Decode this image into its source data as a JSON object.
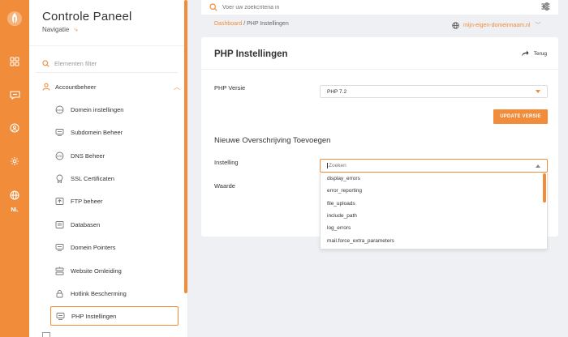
{
  "rail": {
    "icons": [
      "logo-icon",
      "apps-grid-icon",
      "chat-icon",
      "user-circle-icon",
      "gear-icon",
      "globe-icon"
    ],
    "language": "NL"
  },
  "sidebar": {
    "title": "Controle Paneel",
    "subtitle": "Navigatie",
    "filter_placeholder": "Elementen filter",
    "group": {
      "label": "Accountbeheer",
      "icon": "user-icon"
    },
    "items": [
      {
        "label": "Domein instellingen",
        "icon": "domain-settings-icon"
      },
      {
        "label": "Subdomein Beheer",
        "icon": "subdomain-icon"
      },
      {
        "label": "DNS Beheer",
        "icon": "dns-icon"
      },
      {
        "label": "SSL Certificaten",
        "icon": "certificate-icon"
      },
      {
        "label": "FTP beheer",
        "icon": "ftp-icon"
      },
      {
        "label": "Databasen",
        "icon": "database-icon"
      },
      {
        "label": "Domein Pointers",
        "icon": "pointer-icon"
      },
      {
        "label": "Website Omleiding",
        "icon": "redirect-icon"
      },
      {
        "label": "Hotlink Bescherming",
        "icon": "lock-icon"
      },
      {
        "label": "PHP Instellingen",
        "icon": "php-icon",
        "active": true
      }
    ]
  },
  "topbar": {
    "search_placeholder": "Voer uw zoekcriteria in",
    "filter_icon": "sliders-icon"
  },
  "breadcrumb": {
    "home": "Dashboard",
    "separator": " / ",
    "current": "PHP Instellingen"
  },
  "domain_selector": {
    "value": "mijn-eigen-domeinnaam.nl",
    "icon": "globe-icon"
  },
  "card": {
    "title": "PHP Instellingen",
    "back_label": "Terug",
    "php_version_label": "PHP Versie",
    "php_version_value": "PHP 7.2",
    "update_button": "UPDATE VERSIE",
    "section_title": "Nieuwe Overschrijving Toevoegen",
    "setting_label": "Instelling",
    "value_label": "Waarde",
    "setting_search_placeholder": "Zoeken",
    "setting_options": [
      "display_errors",
      "error_reporting",
      "file_uploads",
      "include_path",
      "log_errors",
      "mail.force_extra_parameters"
    ]
  },
  "colors": {
    "accent": "#f08c3a",
    "background": "#eef0f3"
  }
}
